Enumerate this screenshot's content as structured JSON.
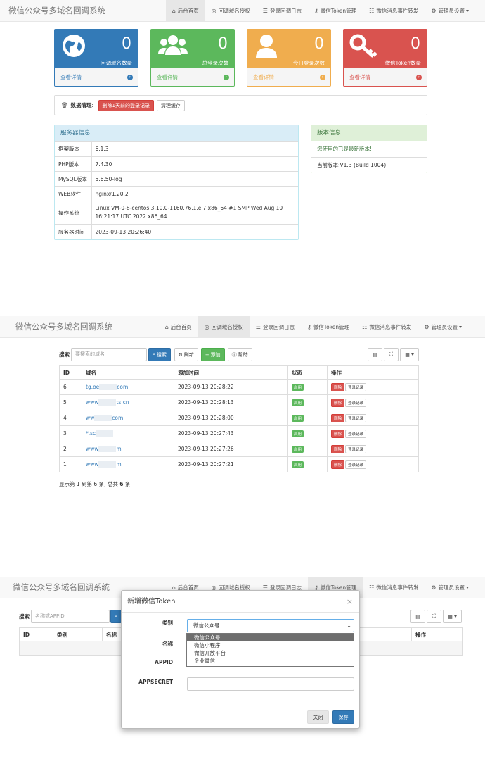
{
  "app": {
    "title": "微信公众号多域名回调系统"
  },
  "nav": {
    "home": "后台首页",
    "domains": "回调域名授权",
    "logs": "登录回调日志",
    "token": "微信Token管理",
    "forward": "微信消息事件转发",
    "admin": "管理员设置"
  },
  "stats": [
    {
      "value": "0",
      "label": "回调域名数量",
      "link": "查看详情",
      "color": "#337ab7",
      "icon": "globe-icon"
    },
    {
      "value": "0",
      "label": "总登录次数",
      "link": "查看详情",
      "color": "#5cb85c",
      "icon": "users-icon"
    },
    {
      "value": "0",
      "label": "今日登录次数",
      "link": "查看详情",
      "color": "#f0ad4e",
      "icon": "user-icon"
    },
    {
      "value": "0",
      "label": "微信Token数量",
      "link": "查看详情",
      "color": "#d9534f",
      "icon": "key-icon"
    }
  ],
  "cleanup": {
    "label": "数据清理:",
    "delete_btn": "删除1天前的登录记录",
    "cache_btn": "清理缓存"
  },
  "server": {
    "title": "服务器信息",
    "rows": [
      {
        "k": "框架版本",
        "v": "6.1.3"
      },
      {
        "k": "PHP版本",
        "v": "7.4.30"
      },
      {
        "k": "MySQL版本",
        "v": "5.6.50-log"
      },
      {
        "k": "WEB软件",
        "v": "nginx/1.20.2"
      },
      {
        "k": "操作系统",
        "v": "Linux VM-0-8-centos 3.10.0-1160.76.1.el7.x86_64 #1 SMP Wed Aug 10 16:21:17 UTC 2022 x86_64"
      },
      {
        "k": "服务器时间",
        "v": "2023-09-13 20:26:40"
      }
    ]
  },
  "version": {
    "title": "版本信息",
    "latest": "您使用的已是最新版本!",
    "current": "当前版本:V1.3 (Build 1004)"
  },
  "domains_page": {
    "search_label": "搜索",
    "search_placeholder": "要搜索的域名",
    "search_btn": "搜索",
    "refresh_btn": "刷新",
    "add_btn": "添加",
    "help_btn": "帮助",
    "columns": [
      "ID",
      "域名",
      "添加时间",
      "状态",
      "操作"
    ],
    "rows": [
      {
        "id": "6",
        "pre": "tg.oe",
        "post": "com",
        "time": "2023-09-13 20:28:22"
      },
      {
        "id": "5",
        "pre": "www",
        "post": "ts.cn",
        "time": "2023-09-13 20:28:13"
      },
      {
        "id": "4",
        "pre": "ww",
        "post": "com",
        "time": "2023-09-13 20:28:00"
      },
      {
        "id": "3",
        "pre": "*.sc",
        "post": "",
        "time": "2023-09-13 20:27:43"
      },
      {
        "id": "2",
        "pre": "www",
        "post": "m",
        "time": "2023-09-13 20:27:26"
      },
      {
        "id": "1",
        "pre": "www",
        "post": "m",
        "time": "2023-09-13 20:27:21"
      }
    ],
    "status": "启用",
    "delete": "删除",
    "login_log": "登录记录",
    "footer_pre": "显示第 1 到第 6 条, 总共 ",
    "footer_count": "6",
    "footer_post": " 条"
  },
  "token_page": {
    "search_label": "搜索",
    "search_placeholder": "名称或APPID",
    "columns": [
      "ID",
      "类别",
      "名称"
    ],
    "op_column": "操作"
  },
  "modal": {
    "title": "新增微信Token",
    "close": "×",
    "type_label": "类别",
    "type_value": "微信公众号",
    "options": [
      "微信公众号",
      "微信小程序",
      "微信开放平台",
      "企业微信"
    ],
    "name_label": "名称",
    "appid_label": "APPID",
    "secret_label": "APPSECRET",
    "close_btn": "关闭",
    "save_btn": "保存"
  }
}
